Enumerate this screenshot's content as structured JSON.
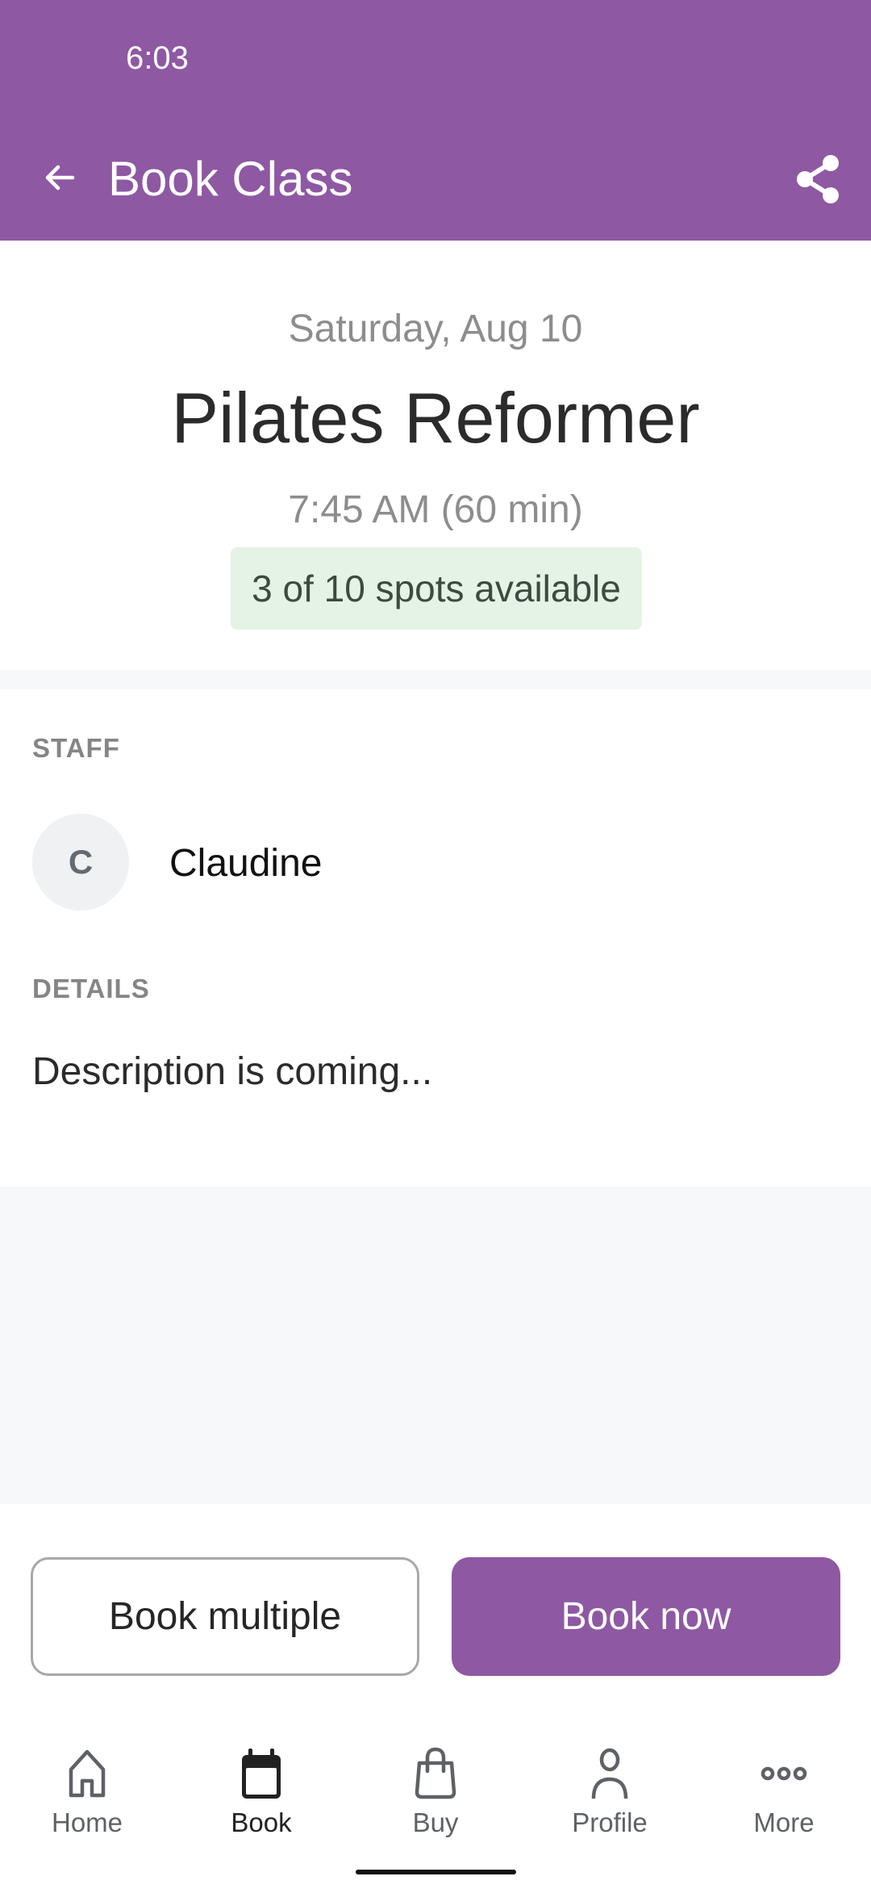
{
  "status_bar": {
    "time": "6:03"
  },
  "app_bar": {
    "title": "Book Class",
    "back_icon": "arrow-left-icon",
    "share_icon": "share-icon",
    "background_color": "#8e58a3"
  },
  "class_info": {
    "date": "Saturday, Aug 10",
    "name": "Pilates Reformer",
    "time": "7:45 AM (60 min)",
    "availability": "3 of 10 spots available",
    "spots_available": 3,
    "spots_total": 10
  },
  "staff_section": {
    "label": "STAFF",
    "staff": [
      {
        "initial": "C",
        "name": "Claudine"
      }
    ]
  },
  "details_section": {
    "label": "DETAILS",
    "description": "Description is coming..."
  },
  "actions": {
    "book_multiple_label": "Book multiple",
    "book_now_label": "Book now",
    "accent_color": "#8e58a3"
  },
  "tab_bar": {
    "active": "Book",
    "items": [
      {
        "label": "Home",
        "icon": "home-icon"
      },
      {
        "label": "Book",
        "icon": "calendar-icon"
      },
      {
        "label": "Buy",
        "icon": "shopping-bag-icon"
      },
      {
        "label": "Profile",
        "icon": "person-icon"
      },
      {
        "label": "More",
        "icon": "more-horizontal-icon"
      }
    ]
  }
}
